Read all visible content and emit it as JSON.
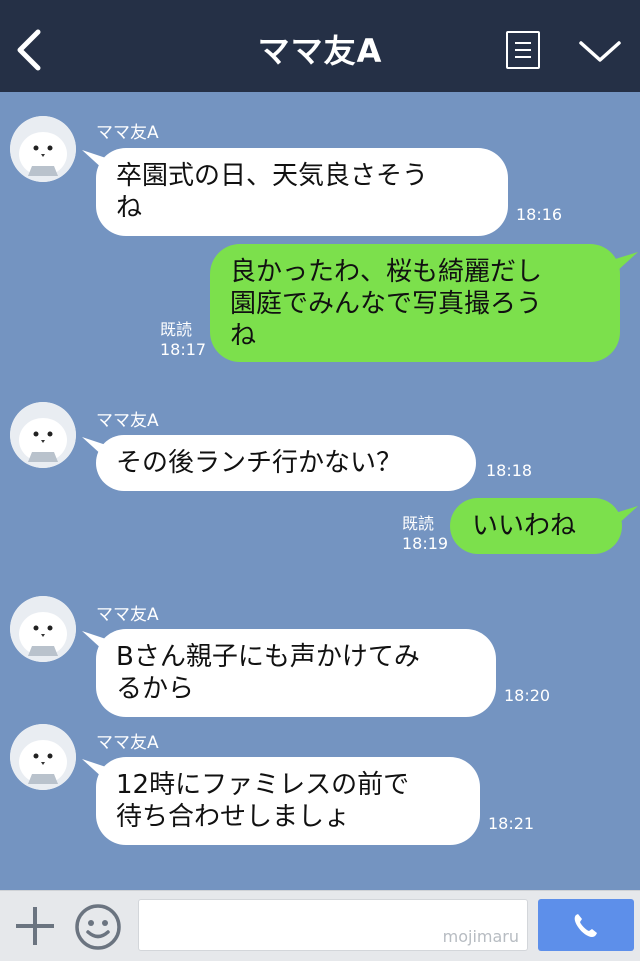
{
  "header": {
    "title": "ママ友A",
    "back_icon": "chevron-left-icon",
    "menu_icon": "list-icon",
    "dropdown_icon": "chevron-down-icon",
    "background": "#253046"
  },
  "chat": {
    "background": "#7494c1",
    "messages": [
      {
        "sender": "ママ友A",
        "lines": [
          "卒園式の日、天気良さそう",
          "ね"
        ],
        "time": "18:16",
        "direction": "incoming"
      },
      {
        "lines": [
          "良かったわ、桜も綺麗だし",
          "園庭でみんなで写真撮ろう",
          "ね"
        ],
        "time": "18:17",
        "read": "既読",
        "direction": "outgoing"
      },
      {
        "sender": "ママ友A",
        "lines": [
          "その後ランチ行かない？"
        ],
        "time": "18:18",
        "direction": "incoming"
      },
      {
        "lines": [
          "いいわね"
        ],
        "time": "18:19",
        "read": "既読",
        "direction": "outgoing"
      },
      {
        "sender": "ママ友A",
        "lines": [
          "Bさん親子にも声かけてみ",
          "るから"
        ],
        "time": "18:20",
        "direction": "incoming"
      },
      {
        "sender": "ママ友A",
        "lines": [
          "12時にファミレスの前で",
          "待ち合わせしましょ"
        ],
        "time": "18:21",
        "direction": "incoming"
      }
    ]
  },
  "footer": {
    "plus_icon": "plus-icon",
    "emoji_icon": "smile-icon",
    "watermark": "mojimaru",
    "call_icon": "phone-icon"
  }
}
